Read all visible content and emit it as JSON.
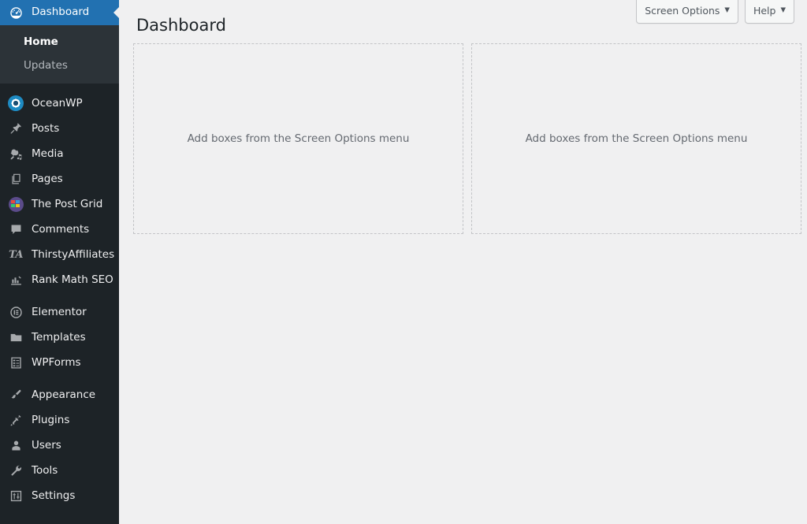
{
  "sidebar": {
    "items": [
      {
        "label": "Dashboard",
        "icon": "dashboard-gauge-icon",
        "current": true
      },
      {
        "label": "OceanWP",
        "icon": "oceanwp-icon",
        "current": false
      },
      {
        "label": "Posts",
        "icon": "pin-icon",
        "current": false
      },
      {
        "label": "Media",
        "icon": "media-camera-icon",
        "current": false
      },
      {
        "label": "Pages",
        "icon": "pages-icon",
        "current": false
      },
      {
        "label": "The Post Grid",
        "icon": "post-grid-icon",
        "current": false
      },
      {
        "label": "Comments",
        "icon": "comment-bubble-icon",
        "current": false
      },
      {
        "label": "ThirstyAffiliates",
        "icon": "thirstyaffiliates-ta-icon",
        "current": false
      },
      {
        "label": "Rank Math SEO",
        "icon": "rank-math-bars-icon",
        "current": false
      },
      {
        "label": "Elementor",
        "icon": "elementor-icon",
        "current": false
      },
      {
        "label": "Templates",
        "icon": "folder-icon",
        "current": false
      },
      {
        "label": "WPForms",
        "icon": "wpforms-clipboard-icon",
        "current": false
      },
      {
        "label": "Appearance",
        "icon": "paintbrush-icon",
        "current": false
      },
      {
        "label": "Plugins",
        "icon": "plug-icon",
        "current": false
      },
      {
        "label": "Users",
        "icon": "user-icon",
        "current": false
      },
      {
        "label": "Tools",
        "icon": "wrench-icon",
        "current": false
      },
      {
        "label": "Settings",
        "icon": "sliders-icon",
        "current": false
      }
    ],
    "submenu": [
      {
        "label": "Home",
        "current": true
      },
      {
        "label": "Updates",
        "current": false
      }
    ],
    "colors": {
      "background": "#1d2327",
      "submenu_background": "#2c3338",
      "current_highlight": "#2271b1",
      "text": "#f0f0f1",
      "icon": "#a7aaad"
    }
  },
  "header": {
    "screen_options_label": "Screen Options",
    "help_label": "Help",
    "caret_glyph": "▼"
  },
  "main": {
    "page_title": "Dashboard",
    "widget_columns": [
      {
        "placeholder": "Add boxes from the Screen Options menu"
      },
      {
        "placeholder": "Add boxes from the Screen Options menu"
      }
    ],
    "background_color": "#f0f0f1",
    "dashed_border_color": "#c3c4c7"
  }
}
